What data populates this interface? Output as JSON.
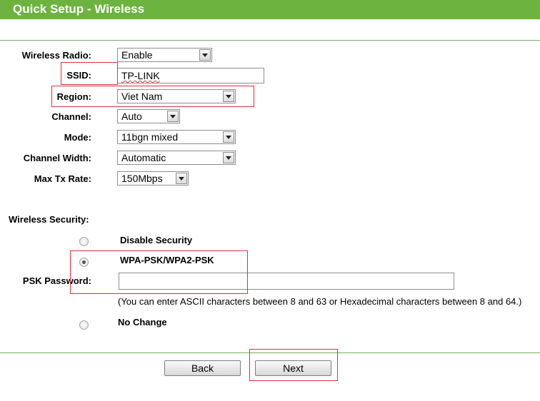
{
  "header": {
    "title": "Quick Setup - Wireless"
  },
  "form": {
    "wireless_radio": {
      "label": "Wireless Radio:",
      "value": "Enable"
    },
    "ssid": {
      "label": "SSID:",
      "value": "TP-LINK"
    },
    "region": {
      "label": "Region:",
      "value": "Viet Nam"
    },
    "channel": {
      "label": "Channel:",
      "value": "Auto"
    },
    "mode": {
      "label": "Mode:",
      "value": "11bgn mixed"
    },
    "channel_width": {
      "label": "Channel Width:",
      "value": "Automatic"
    },
    "max_tx_rate": {
      "label": "Max Tx Rate:",
      "value": "150Mbps"
    }
  },
  "security": {
    "label": "Wireless Security:",
    "options": [
      {
        "label": "Disable Security",
        "selected": false
      },
      {
        "label": "WPA-PSK/WPA2-PSK",
        "selected": true
      },
      {
        "label": "No Change",
        "selected": false
      }
    ],
    "psk_label": "PSK Password:",
    "psk_value": "",
    "hint": "(You can enter ASCII characters between 8 and 63 or Hexadecimal characters between 8 and 64.)"
  },
  "buttons": {
    "back": "Back",
    "next": "Next"
  },
  "colors": {
    "header_bg": "#6cb33f",
    "annotation": "#e0303a"
  }
}
